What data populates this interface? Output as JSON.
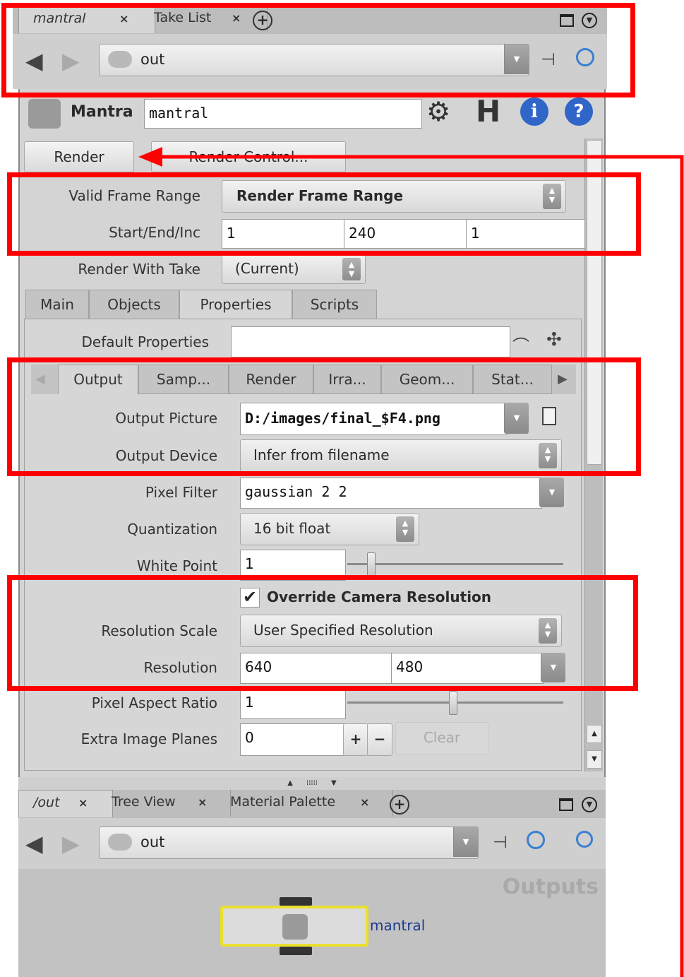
{
  "top_pane": {
    "tabs": [
      {
        "label": "mantral"
      },
      {
        "label": "Take List"
      }
    ],
    "path": "out"
  },
  "node_header": {
    "type_label": "Mantra",
    "name_value": "mantral"
  },
  "render_buttons": {
    "render": "Render",
    "render_control": "Render Control..."
  },
  "frame_range": {
    "label": "Valid Frame Range",
    "value": "Render Frame Range",
    "start_end_inc_label": "Start/End/Inc",
    "start": "1",
    "end": "240",
    "inc": "1"
  },
  "render_with_take": {
    "label": "Render With Take",
    "value": "(Current)"
  },
  "main_tabs": [
    "Main",
    "Objects",
    "Properties",
    "Scripts"
  ],
  "default_properties": {
    "label": "Default Properties",
    "value": ""
  },
  "sub_tabs": [
    "Output",
    "Samp...",
    "Render",
    "Irra...",
    "Geom...",
    "Stat..."
  ],
  "output": {
    "picture_label": "Output Picture",
    "picture_value": "D:/images/final_$F4.png",
    "device_label": "Output Device",
    "device_value": "Infer from filename",
    "filter_label": "Pixel Filter",
    "filter_value": "gaussian 2 2",
    "quant_label": "Quantization",
    "quant_value": "16 bit float",
    "white_label": "White Point",
    "white_value": "1",
    "override_label": "Override Camera Resolution",
    "override_checked": true,
    "res_scale_label": "Resolution Scale",
    "res_scale_value": "User Specified Resolution",
    "res_label": "Resolution",
    "res_x": "640",
    "res_y": "480",
    "aspect_label": "Pixel Aspect Ratio",
    "aspect_value": "1",
    "planes_label": "Extra Image Planes",
    "planes_value": "0",
    "clear_label": "Clear",
    "white_point_level": 0.05,
    "pixel_aspect_level": 0.5
  },
  "bottom_pane": {
    "tabs": [
      {
        "label": "/out"
      },
      {
        "label": "Tree View"
      },
      {
        "label": "Material Palette"
      }
    ],
    "path": "out",
    "network_title": "Outputs",
    "node_label": "mantral"
  },
  "colors": {
    "highlight": "#ff0000",
    "node_border": "#e8e030",
    "panel": "#d4d4d4"
  }
}
